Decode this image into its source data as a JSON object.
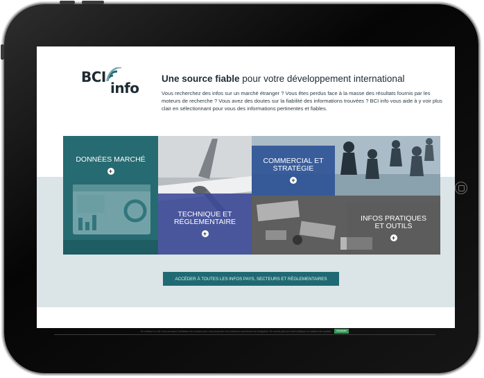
{
  "logo": {
    "part1": "BCI",
    "part2": "info",
    "dot": "."
  },
  "header": {
    "headline_bold": "Une source fiable",
    "headline_rest": " pour votre développement international",
    "intro": "Vous recherchez des infos sur un marché étranger ? Vous êtes perdus face à la masse des résultats fournis par les moteurs de recherche ? Vous avez des doutes sur la fiabilité des informations trouvées ? BCI info vous aide à y voir plus clair en sélectionnant pour vous des informations pertinentes et fiables."
  },
  "tiles": {
    "donnees": {
      "label": "DONNÉES MARCHÉ"
    },
    "commercial": {
      "line1": "COMMERCIAL ET",
      "line2": "STRATÉGIE"
    },
    "technique": {
      "line1": "TECHNIQUE ET",
      "line2": "RÉGLEMENTAIRE"
    },
    "infos": {
      "line1": "INFOS PRATIQUES",
      "line2": "ET OUTILS"
    }
  },
  "plus_glyph": "+",
  "cta": {
    "label": "ACCÉDER À TOUTES LES INFOS PAYS, SECTEURS ET RÉGLEMENTAIRES"
  },
  "cookie": {
    "text": "En utilisant ce site vous acceptez l'utilisation de cookies pour vous proposer une meilleure expérience de navigation. En savoir plus sur notre politique en matière de cookies.",
    "accept": "Accepter"
  },
  "colors": {
    "teal": "#1f6a72",
    "navy": "#2c3e82",
    "light_band": "#dbe4e7",
    "text": "#1e2a33"
  },
  "icons": [
    "plus-circle-icon",
    "signal-arc-icon",
    "home-button-icon"
  ]
}
